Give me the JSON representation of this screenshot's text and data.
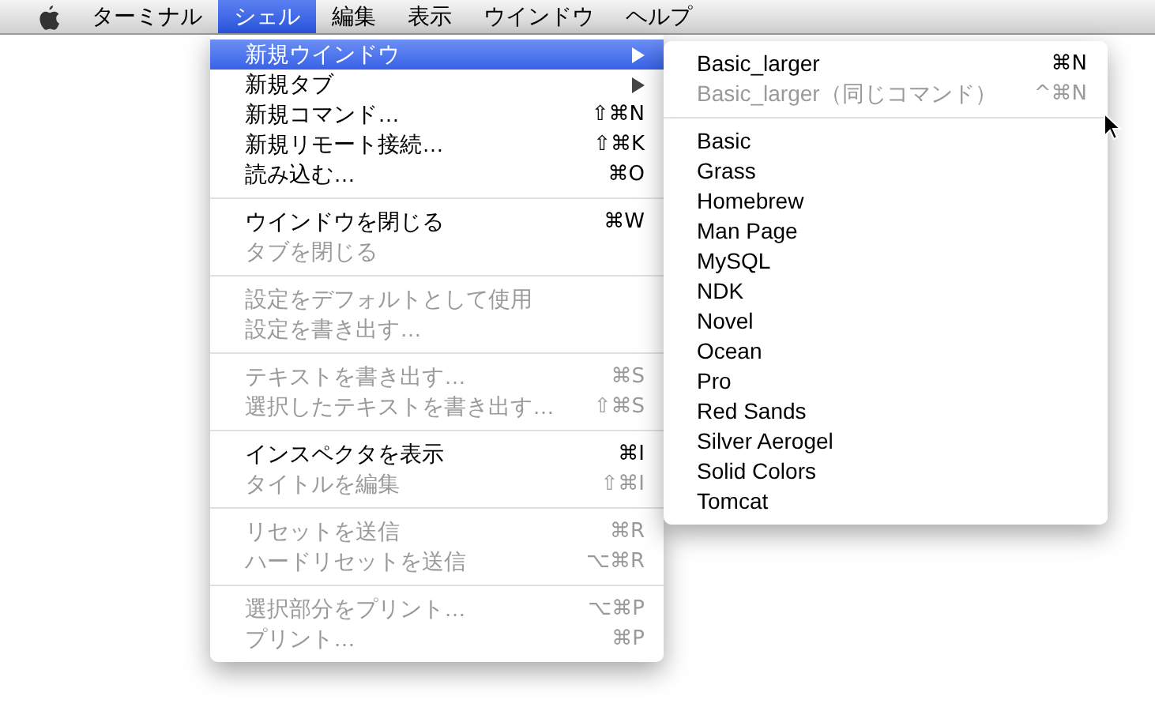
{
  "menubar": [
    {
      "kind": "apple",
      "selected": false
    },
    {
      "kind": "text",
      "label": "ターミナル",
      "selected": false
    },
    {
      "kind": "text",
      "label": "シェル",
      "selected": true
    },
    {
      "kind": "text",
      "label": "編集",
      "selected": false
    },
    {
      "kind": "text",
      "label": "表示",
      "selected": false
    },
    {
      "kind": "text",
      "label": "ウインドウ",
      "selected": false
    },
    {
      "kind": "text",
      "label": "ヘルプ",
      "selected": false
    }
  ],
  "menu": {
    "groups": [
      [
        {
          "label": "新規ウインドウ",
          "submenu": true,
          "selected": true,
          "disabled": false
        },
        {
          "label": "新規タブ",
          "submenu": true,
          "selected": false,
          "disabled": false
        },
        {
          "label": "新規コマンド…",
          "shortcut": "⇧⌘N",
          "selected": false,
          "disabled": false
        },
        {
          "label": "新規リモート接続…",
          "shortcut": "⇧⌘K",
          "selected": false,
          "disabled": false
        },
        {
          "label": "読み込む…",
          "shortcut": "⌘O",
          "selected": false,
          "disabled": false
        }
      ],
      [
        {
          "label": "ウインドウを閉じる",
          "shortcut": "⌘W",
          "selected": false,
          "disabled": false
        },
        {
          "label": "タブを閉じる",
          "selected": false,
          "disabled": true
        }
      ],
      [
        {
          "label": "設定をデフォルトとして使用",
          "selected": false,
          "disabled": true
        },
        {
          "label": "設定を書き出す…",
          "selected": false,
          "disabled": true
        }
      ],
      [
        {
          "label": "テキストを書き出す…",
          "shortcut": "⌘S",
          "selected": false,
          "disabled": true
        },
        {
          "label": "選択したテキストを書き出す…",
          "shortcut": "⇧⌘S",
          "selected": false,
          "disabled": true
        }
      ],
      [
        {
          "label": "インスペクタを表示",
          "shortcut": "⌘I",
          "selected": false,
          "disabled": false
        },
        {
          "label": "タイトルを編集",
          "shortcut": "⇧⌘I",
          "selected": false,
          "disabled": true
        }
      ],
      [
        {
          "label": "リセットを送信",
          "shortcut": "⌘R",
          "selected": false,
          "disabled": true
        },
        {
          "label": "ハードリセットを送信",
          "shortcut": "⌥⌘R",
          "selected": false,
          "disabled": true
        }
      ],
      [
        {
          "label": "選択部分をプリント…",
          "shortcut": "⌥⌘P",
          "selected": false,
          "disabled": true
        },
        {
          "label": "プリント…",
          "shortcut": "⌘P",
          "selected": false,
          "disabled": true
        }
      ]
    ]
  },
  "submenu": {
    "groups": [
      [
        {
          "label": "Basic_larger",
          "shortcut": "⌘N",
          "disabled": false
        },
        {
          "label": "Basic_larger（同じコマンド）",
          "shortcut": "^⌘N",
          "disabled": true
        }
      ],
      [
        {
          "label": "Basic",
          "disabled": false
        },
        {
          "label": "Grass",
          "disabled": false
        },
        {
          "label": "Homebrew",
          "disabled": false
        },
        {
          "label": "Man Page",
          "disabled": false
        },
        {
          "label": "MySQL",
          "disabled": false
        },
        {
          "label": "NDK",
          "disabled": false
        },
        {
          "label": "Novel",
          "disabled": false
        },
        {
          "label": "Ocean",
          "disabled": false
        },
        {
          "label": "Pro",
          "disabled": false
        },
        {
          "label": "Red Sands",
          "disabled": false
        },
        {
          "label": "Silver Aerogel",
          "disabled": false
        },
        {
          "label": "Solid Colors",
          "disabled": false
        },
        {
          "label": "Tomcat",
          "disabled": false
        }
      ]
    ]
  }
}
